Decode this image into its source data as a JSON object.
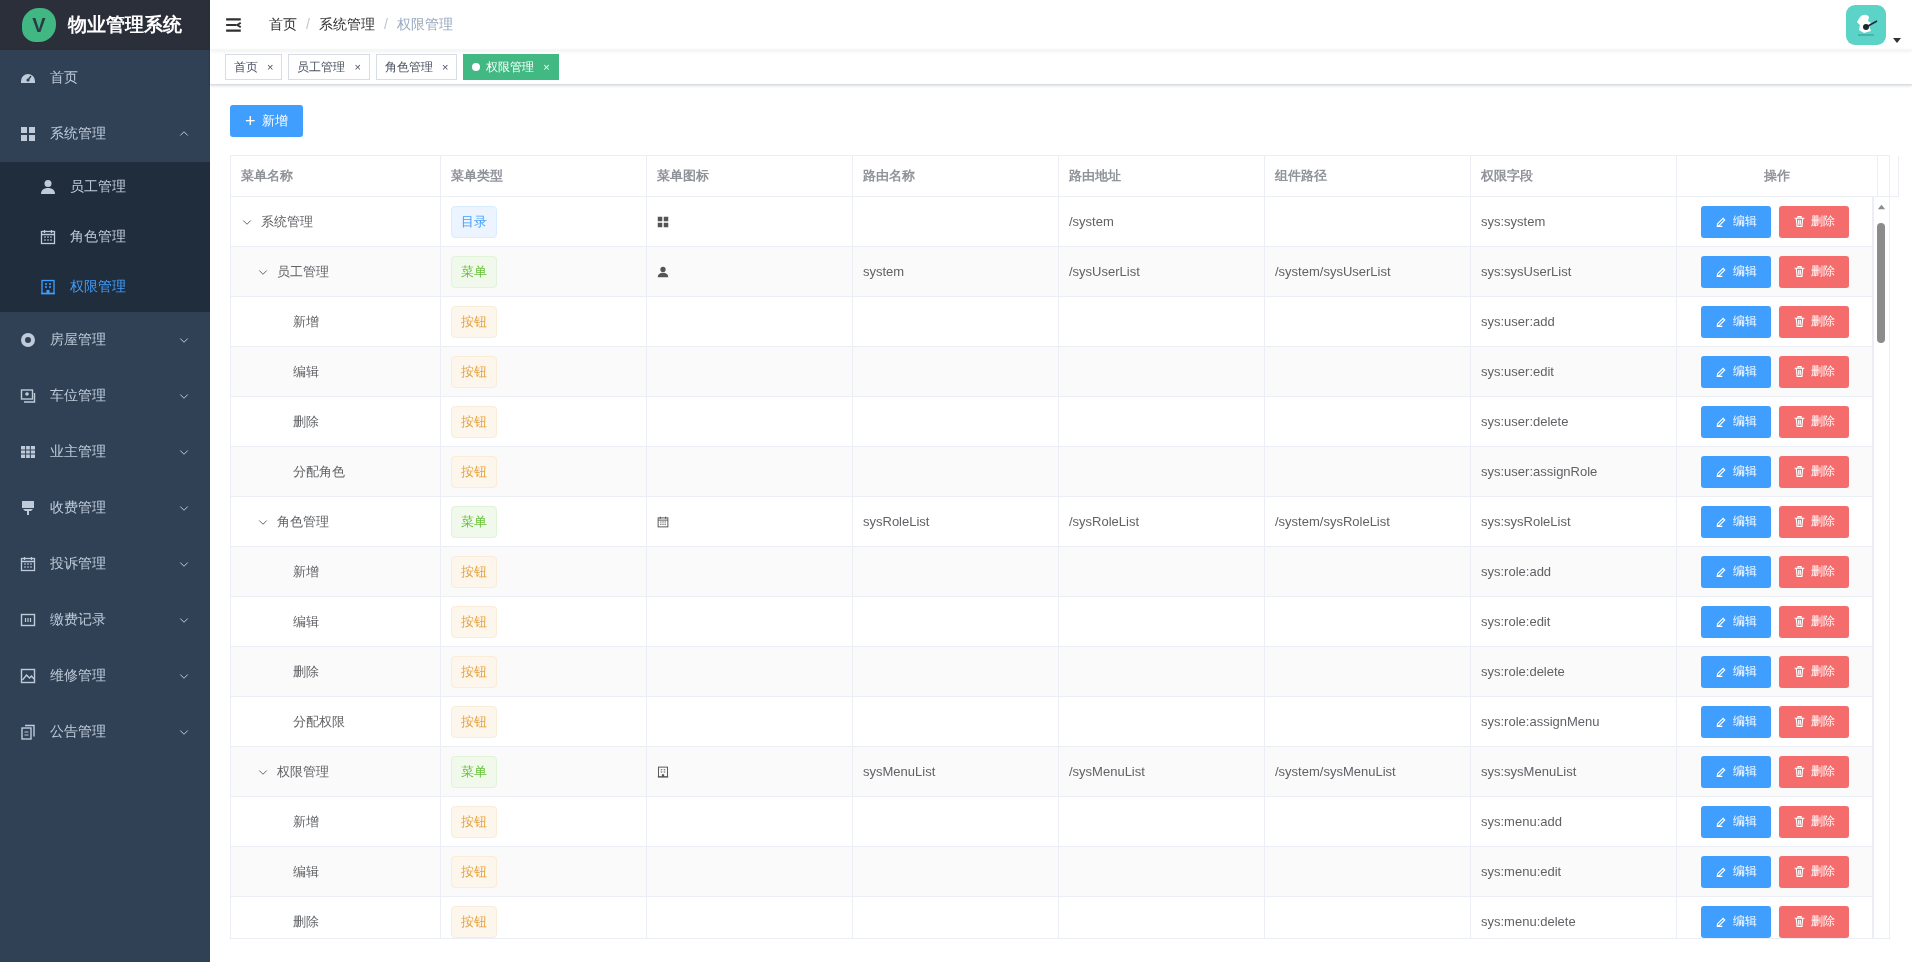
{
  "sidebar": {
    "logo": "V",
    "title": "物业管理系统",
    "items": [
      {
        "label": "首页",
        "selected": false
      },
      {
        "label": "系统管理",
        "selected": false,
        "expanded": true,
        "children": [
          {
            "label": "员工管理",
            "selected": false
          },
          {
            "label": "角色管理",
            "selected": false
          },
          {
            "label": "权限管理",
            "selected": true
          }
        ]
      },
      {
        "label": "房屋管理",
        "selected": false,
        "expanded": false
      },
      {
        "label": "车位管理",
        "selected": false,
        "expanded": false
      },
      {
        "label": "业主管理",
        "selected": false,
        "expanded": false
      },
      {
        "label": "收费管理",
        "selected": false,
        "expanded": false
      },
      {
        "label": "投诉管理",
        "selected": false,
        "expanded": false
      },
      {
        "label": "缴费记录",
        "selected": false,
        "expanded": false
      },
      {
        "label": "维修管理",
        "selected": false,
        "expanded": false
      },
      {
        "label": "公告管理",
        "selected": false,
        "expanded": false
      }
    ]
  },
  "breadcrumb": {
    "items": [
      {
        "label": "首页",
        "current": false
      },
      {
        "label": "系统管理",
        "current": false
      },
      {
        "label": "权限管理",
        "current": true
      }
    ],
    "separators": [
      "/",
      "/"
    ]
  },
  "tabs": [
    {
      "label": "首页",
      "close": "×",
      "selected": false
    },
    {
      "label": "员工管理",
      "close": "×",
      "selected": false
    },
    {
      "label": "角色管理",
      "close": "×",
      "selected": false
    },
    {
      "label": "权限管理",
      "close": "×",
      "selected": true
    }
  ],
  "add_button": {
    "icon": "+",
    "label": "新增"
  },
  "table": {
    "columns": [
      "菜单名称",
      "菜单类型",
      "菜单图标",
      "路由名称",
      "路由地址",
      "组件路径",
      "权限字段",
      "操作"
    ],
    "rows": [
      {
        "name": "系统管理",
        "type": {
          "label": "目录",
          "kind": "directory"
        },
        "route_name": "",
        "route_path": "/system",
        "component": "",
        "perm": "sys:system",
        "actions": [
          {
            "kind": "edit",
            "label": "编辑"
          },
          {
            "kind": "delete",
            "label": "删除"
          }
        ],
        "expanded": true,
        "children": [
          {
            "name": "员工管理",
            "type": {
              "label": "菜单",
              "kind": "menu"
            },
            "route_name": "system",
            "route_path": "/sysUserList",
            "component": "/system/sysUserList",
            "perm": "sys:sysUserList",
            "actions": [
              {
                "kind": "edit",
                "label": "编辑"
              },
              {
                "kind": "delete",
                "label": "删除"
              }
            ],
            "expanded": true,
            "children": [
              {
                "name": "新增",
                "type": {
                  "label": "按钮",
                  "kind": "button"
                },
                "perm": "sys:user:add",
                "actions": [
                  {
                    "kind": "edit",
                    "label": "编辑"
                  },
                  {
                    "kind": "delete",
                    "label": "删除"
                  }
                ]
              },
              {
                "name": "编辑",
                "type": {
                  "label": "按钮",
                  "kind": "button"
                },
                "perm": "sys:user:edit",
                "actions": [
                  {
                    "kind": "edit",
                    "label": "编辑"
                  },
                  {
                    "kind": "delete",
                    "label": "删除"
                  }
                ]
              },
              {
                "name": "删除",
                "type": {
                  "label": "按钮",
                  "kind": "button"
                },
                "perm": "sys:user:delete",
                "actions": [
                  {
                    "kind": "edit",
                    "label": "编辑"
                  },
                  {
                    "kind": "delete",
                    "label": "删除"
                  }
                ]
              },
              {
                "name": "分配角色",
                "type": {
                  "label": "按钮",
                  "kind": "button"
                },
                "perm": "sys:user:assignRole",
                "actions": [
                  {
                    "kind": "edit",
                    "label": "编辑"
                  },
                  {
                    "kind": "delete",
                    "label": "删除"
                  }
                ]
              }
            ]
          },
          {
            "name": "角色管理",
            "type": {
              "label": "菜单",
              "kind": "menu"
            },
            "route_name": "sysRoleList",
            "route_path": "/sysRoleList",
            "component": "/system/sysRoleList",
            "perm": "sys:sysRoleList",
            "actions": [
              {
                "kind": "edit",
                "label": "编辑"
              },
              {
                "kind": "delete",
                "label": "删除"
              }
            ],
            "expanded": true,
            "children": [
              {
                "name": "新增",
                "type": {
                  "label": "按钮",
                  "kind": "button"
                },
                "perm": "sys:role:add",
                "actions": [
                  {
                    "kind": "edit",
                    "label": "编辑"
                  },
                  {
                    "kind": "delete",
                    "label": "删除"
                  }
                ]
              },
              {
                "name": "编辑",
                "type": {
                  "label": "按钮",
                  "kind": "button"
                },
                "perm": "sys:role:edit",
                "actions": [
                  {
                    "kind": "edit",
                    "label": "编辑"
                  },
                  {
                    "kind": "delete",
                    "label": "删除"
                  }
                ]
              },
              {
                "name": "删除",
                "type": {
                  "label": "按钮",
                  "kind": "button"
                },
                "perm": "sys:role:delete",
                "actions": [
                  {
                    "kind": "edit",
                    "label": "编辑"
                  },
                  {
                    "kind": "delete",
                    "label": "删除"
                  }
                ]
              },
              {
                "name": "分配权限",
                "type": {
                  "label": "按钮",
                  "kind": "button"
                },
                "perm": "sys:role:assignMenu",
                "actions": [
                  {
                    "kind": "edit",
                    "label": "编辑"
                  },
                  {
                    "kind": "delete",
                    "label": "删除"
                  }
                ]
              }
            ]
          },
          {
            "name": "权限管理",
            "type": {
              "label": "菜单",
              "kind": "menu"
            },
            "route_name": "sysMenuList",
            "route_path": "/sysMenuList",
            "component": "/system/sysMenuList",
            "perm": "sys:sysMenuList",
            "actions": [
              {
                "kind": "edit",
                "label": "编辑"
              },
              {
                "kind": "delete",
                "label": "删除"
              }
            ],
            "expanded": true,
            "children": [
              {
                "name": "新增",
                "type": {
                  "label": "按钮",
                  "kind": "button"
                },
                "perm": "sys:menu:add",
                "actions": [
                  {
                    "kind": "edit",
                    "label": "编辑"
                  },
                  {
                    "kind": "delete",
                    "label": "删除"
                  }
                ]
              },
              {
                "name": "编辑",
                "type": {
                  "label": "按钮",
                  "kind": "button"
                },
                "perm": "sys:menu:edit",
                "actions": [
                  {
                    "kind": "edit",
                    "label": "编辑"
                  },
                  {
                    "kind": "delete",
                    "label": "删除"
                  }
                ]
              },
              {
                "name": "删除",
                "type": {
                  "label": "按钮",
                  "kind": "button"
                },
                "perm": "sys:menu:delete",
                "actions": [
                  {
                    "kind": "edit",
                    "label": "编辑"
                  },
                  {
                    "kind": "delete",
                    "label": "删除"
                  }
                ]
              }
            ]
          }
        ]
      }
    ]
  }
}
